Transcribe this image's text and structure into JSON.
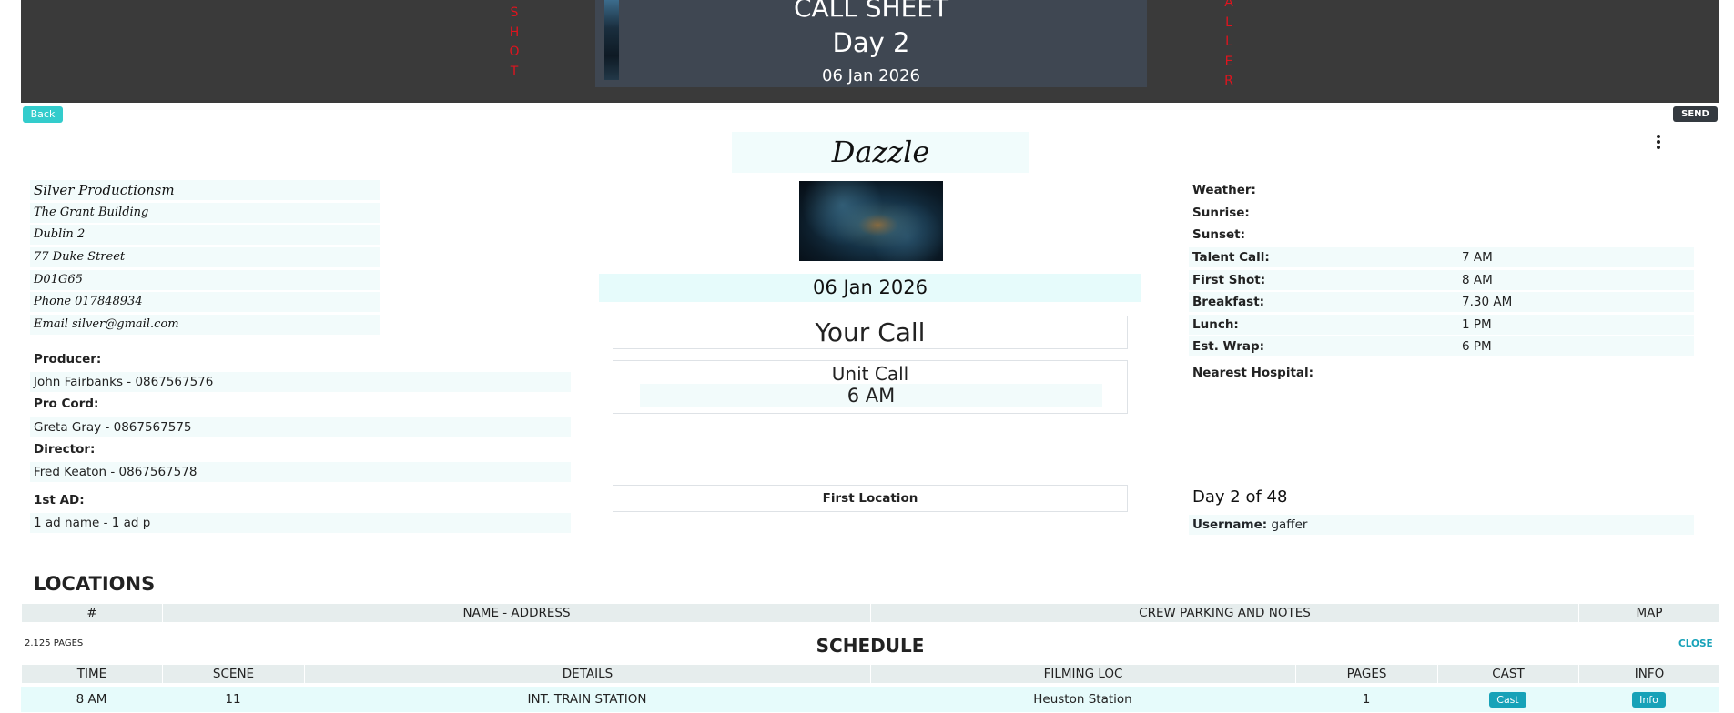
{
  "header": {
    "left_vertical": [
      "S",
      "H",
      "O",
      "T"
    ],
    "right_vertical": [
      "A",
      "L",
      "L",
      "E",
      "R"
    ],
    "title": "CALL SHEET",
    "day": "Day 2",
    "date": "06 Jan 2026"
  },
  "toolbar": {
    "back_label": "Back",
    "send_label": "SEND"
  },
  "production": {
    "title": "Dazzle"
  },
  "company": {
    "name": "Silver Productionsm",
    "address_lines": [
      "The Grant Building",
      "Dublin 2",
      "77 Duke Street",
      "D01G65"
    ],
    "phone": "Phone 017848934",
    "email": "Email silver@gmail.com"
  },
  "crew": [
    {
      "role": "Producer:",
      "value": "John Fairbanks - 0867567576"
    },
    {
      "role": "Pro Cord:",
      "value": "Greta Gray - 0867567575"
    },
    {
      "role": "Director:",
      "value": "Fred Keaton - 0867567578"
    },
    {
      "role": "1st AD:",
      "value": "1 ad name - 1 ad p"
    }
  ],
  "center": {
    "date": "06 Jan 2026",
    "your_call": "Your Call",
    "unit_call_label": "Unit Call",
    "unit_call_value": "6 AM",
    "first_location": "First Location"
  },
  "info": {
    "weather_label": "Weather:",
    "sunrise_label": "Sunrise:",
    "sunset_label": "Sunset:",
    "times": [
      {
        "label": "Talent Call:",
        "value": "7 AM"
      },
      {
        "label": "First Shot:",
        "value": "8 AM"
      },
      {
        "label": "Breakfast:",
        "value": "7.30 AM"
      },
      {
        "label": "Lunch:",
        "value": "1 PM"
      },
      {
        "label": "Est. Wrap:",
        "value": "6 PM"
      }
    ],
    "hospital_label": "Nearest Hospital:",
    "day_count": "Day 2 of 48",
    "username_label": "Username:",
    "username": "gaffer"
  },
  "locations": {
    "title": "LOCATIONS",
    "columns": [
      "#",
      "NAME - ADDRESS",
      "CREW PARKING AND NOTES",
      "MAP"
    ]
  },
  "schedule": {
    "title": "SCHEDULE",
    "pages": "2.125 PAGES",
    "close_label": "CLOSE",
    "columns": [
      "TIME",
      "SCENE",
      "DETAILS",
      "FILMING LOC",
      "PAGES",
      "CAST",
      "INFO"
    ],
    "rows": [
      {
        "time": "8 AM",
        "scene": "11",
        "details": "INT. TRAIN STATION",
        "filming_loc": "Heuston Station",
        "pages": "1",
        "cast_btn": "Cast",
        "info_btn": "Info"
      }
    ]
  }
}
